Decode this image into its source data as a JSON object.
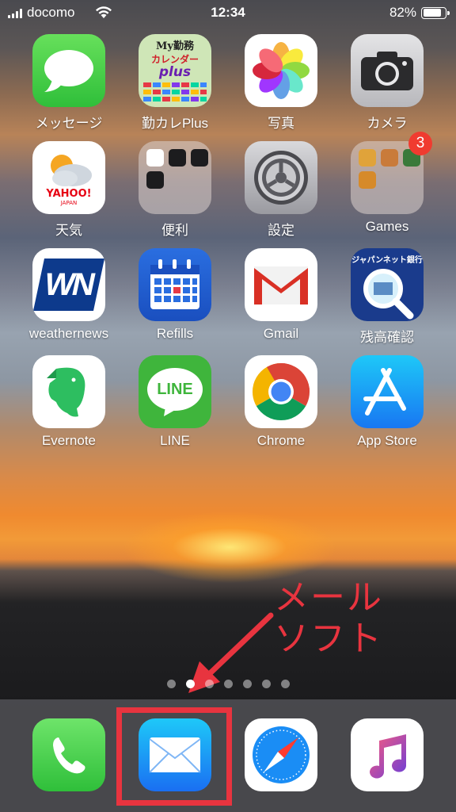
{
  "status_bar": {
    "carrier": "docomo",
    "time": "12:34",
    "battery": "82%",
    "battery_level": 0.82
  },
  "apps": [
    {
      "label": "メッセージ",
      "icon": "messages-icon"
    },
    {
      "label": "勤カレPlus",
      "icon": "kinkare-plus-icon",
      "icon_text": [
        "My勤務",
        "カレンダー",
        "plus"
      ]
    },
    {
      "label": "写真",
      "icon": "photos-icon"
    },
    {
      "label": "カメラ",
      "icon": "camera-icon"
    },
    {
      "label": "天気",
      "icon": "yahoo-weather-icon",
      "icon_text": [
        "YAHOO!",
        "JAPAN"
      ]
    },
    {
      "label": "便利",
      "icon": "folder-icon"
    },
    {
      "label": "設定",
      "icon": "settings-icon"
    },
    {
      "label": "Games",
      "icon": "games-folder-icon",
      "badge": "3"
    },
    {
      "label": "weathernews",
      "icon": "weathernews-icon",
      "icon_text": [
        "WN"
      ]
    },
    {
      "label": "Refills",
      "icon": "refills-icon"
    },
    {
      "label": "Gmail",
      "icon": "gmail-icon"
    },
    {
      "label": "残高確認",
      "icon": "japannet-bank-icon",
      "icon_text": [
        "ジャパンネット銀行"
      ]
    },
    {
      "label": "Evernote",
      "icon": "evernote-icon"
    },
    {
      "label": "LINE",
      "icon": "line-icon",
      "icon_text": [
        "LINE"
      ]
    },
    {
      "label": "Chrome",
      "icon": "chrome-icon"
    },
    {
      "label": "App Store",
      "icon": "app-store-icon"
    }
  ],
  "page_dots": {
    "count": 7,
    "active": 1
  },
  "dock": [
    {
      "icon": "phone-icon"
    },
    {
      "icon": "mail-icon"
    },
    {
      "icon": "safari-icon"
    },
    {
      "icon": "music-icon"
    }
  ],
  "annotation": {
    "line1": "メール",
    "line2": "ソフト",
    "color": "#e8343f"
  }
}
